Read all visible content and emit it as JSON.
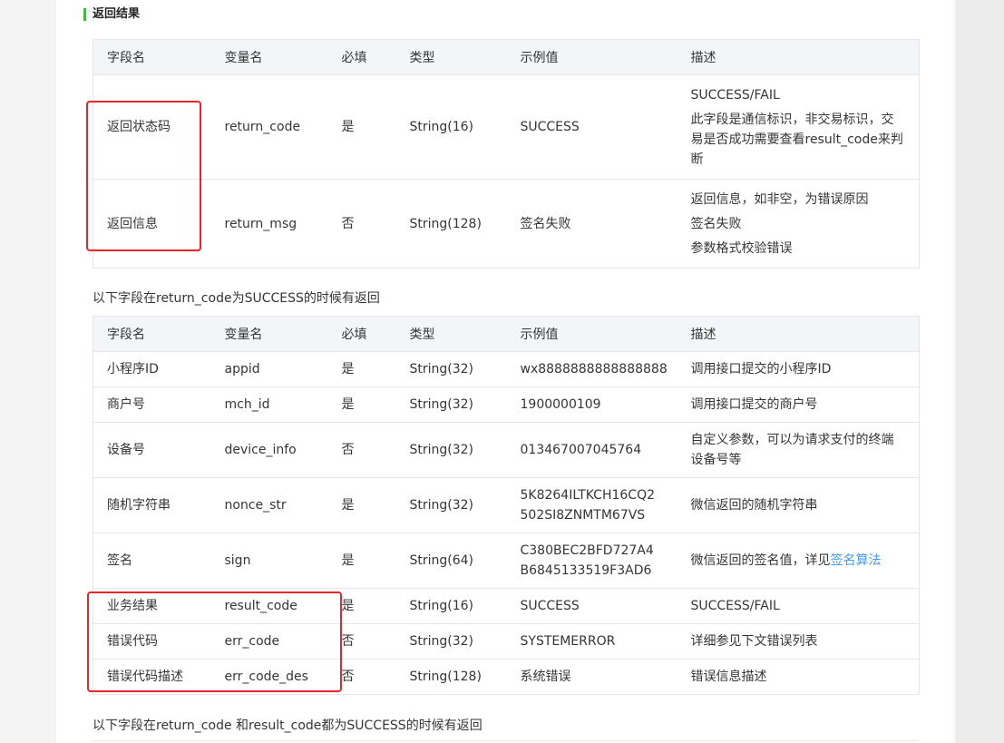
{
  "section_title": "返回结果",
  "table1": {
    "headers": [
      "字段名",
      "变量名",
      "必填",
      "类型",
      "示例值",
      "描述"
    ],
    "rows": [
      {
        "field": "返回状态码",
        "var": "return_code",
        "required": "是",
        "type": "String(16)",
        "example": "SUCCESS",
        "desc1": "SUCCESS/FAIL",
        "desc2": "此字段是通信标识，非交易标识，交易是否成功需要查看result_code来判断"
      },
      {
        "field": "返回信息",
        "var": "return_msg",
        "required": "否",
        "type": "String(128)",
        "example": "签名失败",
        "desc1": "返回信息，如非空，为错误原因",
        "desc2": "签名失败",
        "desc3": "参数格式校验错误"
      }
    ]
  },
  "note1": "以下字段在return_code为SUCCESS的时候有返回",
  "table2": {
    "headers": [
      "字段名",
      "变量名",
      "必填",
      "类型",
      "示例值",
      "描述"
    ],
    "rows": [
      {
        "field": "小程序ID",
        "var": "appid",
        "required": "是",
        "type": "String(32)",
        "example": "wx8888888888888888",
        "desc": "调用接口提交的小程序ID"
      },
      {
        "field": "商户号",
        "var": "mch_id",
        "required": "是",
        "type": "String(32)",
        "example": "1900000109",
        "desc": "调用接口提交的商户号"
      },
      {
        "field": "设备号",
        "var": "device_info",
        "required": "否",
        "type": "String(32)",
        "example": "013467007045764",
        "desc": "自定义参数，可以为请求支付的终端设备号等"
      },
      {
        "field": "随机字符串",
        "var": "nonce_str",
        "required": "是",
        "type": "String(32)",
        "example": "5K8264ILTKCH16CQ2502SI8ZNMTM67VS",
        "desc": "微信返回的随机字符串"
      },
      {
        "field": "签名",
        "var": "sign",
        "required": "是",
        "type": "String(64)",
        "example": "C380BEC2BFD727A4B6845133519F3AD6",
        "desc": "微信返回的签名值，详见",
        "desc_link": "签名算法"
      },
      {
        "field": "业务结果",
        "var": "result_code",
        "required": "是",
        "type": "String(16)",
        "example": "SUCCESS",
        "desc": "SUCCESS/FAIL"
      },
      {
        "field": "错误代码",
        "var": "err_code",
        "required": "否",
        "type": "String(32)",
        "example": "SYSTEMERROR",
        "desc": "详细参见下文错误列表"
      },
      {
        "field": "错误代码描述",
        "var": "err_code_des",
        "required": "否",
        "type": "String(128)",
        "example": "系统错误",
        "desc": "错误信息描述"
      }
    ]
  },
  "note2": "以下字段在return_code 和result_code都为SUCCESS的时候有返回",
  "colors": {
    "accent": "#44b549",
    "link": "#459ae9",
    "highlight_box": "#e5262c"
  }
}
